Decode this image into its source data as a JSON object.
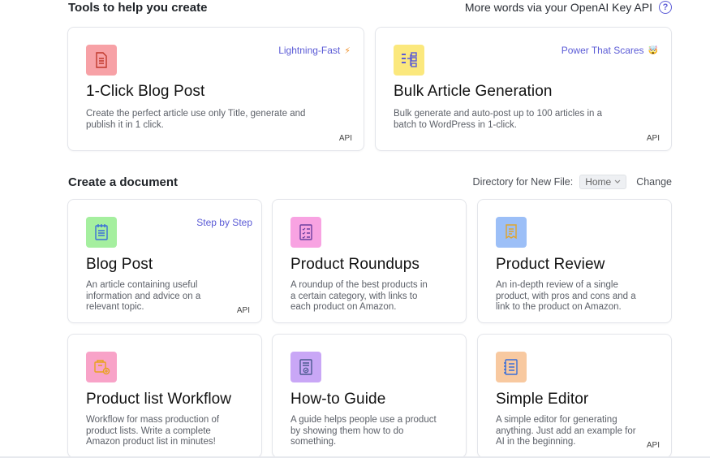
{
  "tools_section": {
    "title": "Tools to help you create",
    "openai_link": "More words via your OpenAI Key API",
    "help_glyph": "?"
  },
  "tools": [
    {
      "title": "1-Click Blog Post",
      "desc_line1": "Create the perfect article use only Title, generate and",
      "desc_line2": "publish it in 1 click.",
      "badge": "Lightning-Fast",
      "badge_glyph": "⚡",
      "api": "API",
      "icon": "document-icon",
      "color": "#f7a1a6"
    },
    {
      "title": "Bulk Article Generation",
      "desc_line1": "Bulk generate and auto-post up to 100 articles in a",
      "desc_line2": "batch to WordPress in 1-click.",
      "badge": "Power That Scares",
      "badge_glyph": "🤯",
      "api": "API",
      "icon": "flowchart-icon",
      "color": "#fbe87d"
    }
  ],
  "documents_section": {
    "title": "Create a document",
    "directory_label": "Directory for New File:",
    "directory_value": "Home",
    "change_label": "Change"
  },
  "documents": [
    {
      "title": "Blog Post",
      "desc_line1": "An article containing useful",
      "desc_line2": "information and advice on a",
      "desc_line3": "relevant topic.",
      "badge": "Step by Step",
      "api": "API",
      "icon": "notebook-icon",
      "color": "#a5ef9f"
    },
    {
      "title": "Product Roundups",
      "desc_line1": "A roundup of the best products in",
      "desc_line2": "a certain category, with links to",
      "desc_line3": "each product on Amazon.",
      "icon": "checklist-icon",
      "color": "#f8a3e2"
    },
    {
      "title": "Product Review",
      "desc_line1": "An in-depth review of a single",
      "desc_line2": "product, with pros and cons and a",
      "desc_line3": "link to the product on Amazon.",
      "icon": "receipt-icon",
      "color": "#9cbff7"
    },
    {
      "title": "Product list Workflow",
      "desc_line1": "Workflow for mass production of",
      "desc_line2": "product lists. Write a complete",
      "desc_line3": "Amazon product list in minutes!",
      "icon": "cart-icon",
      "color": "#f8a3c8"
    },
    {
      "title": "How-to Guide",
      "desc_line1": "A guide helps people use a product",
      "desc_line2": "by showing them how to do",
      "desc_line3": "something.",
      "icon": "guide-icon",
      "color": "#c9a7f6"
    },
    {
      "title": "Simple Editor",
      "desc_line1": "A simple editor for generating",
      "desc_line2": "anything. Just add an example for",
      "desc_line3": "AI in the beginning.",
      "api": "API",
      "icon": "notepad-icon",
      "color": "#f8c9a0"
    }
  ]
}
